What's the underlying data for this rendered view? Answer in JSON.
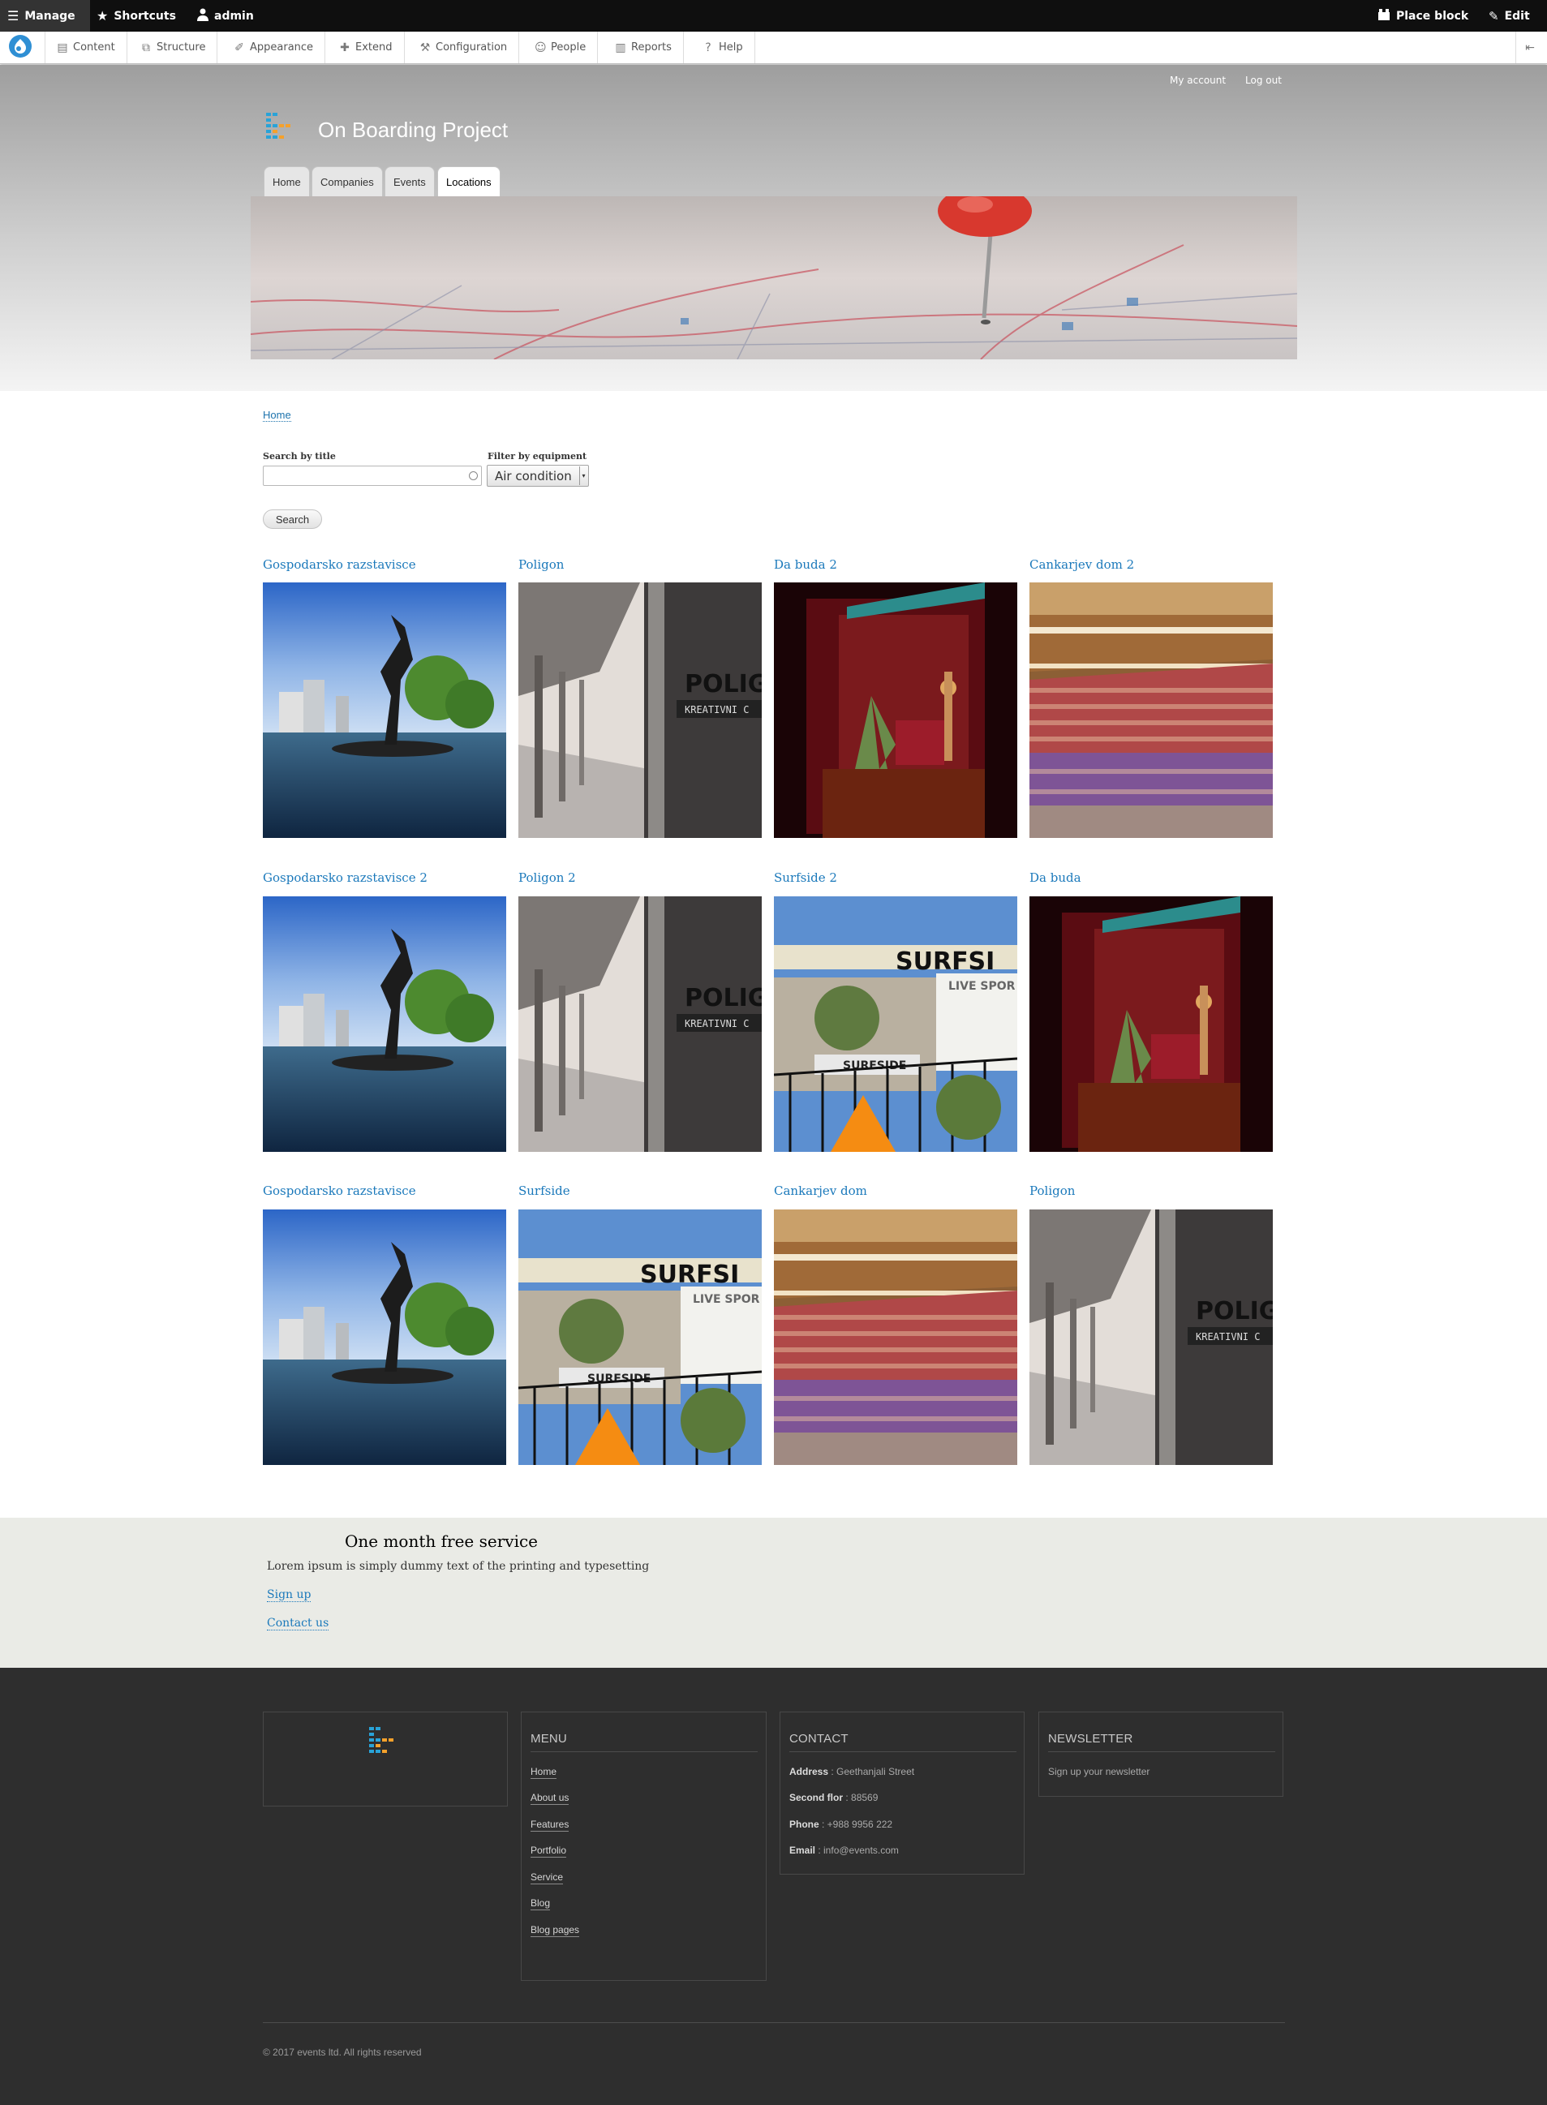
{
  "toolbar": {
    "manage": "Manage",
    "shortcuts": "Shortcuts",
    "user": "admin",
    "place_block": "Place block",
    "edit": "Edit"
  },
  "admin_tray": {
    "items": [
      "Content",
      "Structure",
      "Appearance",
      "Extend",
      "Configuration",
      "People",
      "Reports",
      "Help"
    ]
  },
  "header": {
    "my_account": "My account",
    "log_out": "Log out",
    "site_name": "On Boarding Project",
    "tabs": [
      "Home",
      "Companies",
      "Events",
      "Locations"
    ],
    "active_tab": "Locations"
  },
  "breadcrumb": {
    "home": "Home"
  },
  "filters": {
    "search_label": "Search by title",
    "search_value": "",
    "equipment_label": "Filter by equipment",
    "equipment_value": "Air condition",
    "search_button": "Search"
  },
  "locations": [
    {
      "title": "Gospodarsko razstavisce",
      "image": "fountain-statue"
    },
    {
      "title": "Poligon",
      "image": "poligon-corridor"
    },
    {
      "title": "Da buda 2",
      "image": "red-lounge"
    },
    {
      "title": "Cankarjev dom 2",
      "image": "concert-hall"
    },
    {
      "title": "Gospodarsko razstavisce 2",
      "image": "fountain-statue"
    },
    {
      "title": "Poligon 2",
      "image": "poligon-corridor"
    },
    {
      "title": "Surfside 2",
      "image": "surfside-terrace"
    },
    {
      "title": "Da buda",
      "image": "red-lounge"
    },
    {
      "title": "Gospodarsko razstavisce",
      "image": "fountain-statue"
    },
    {
      "title": "Surfside",
      "image": "surfside-terrace"
    },
    {
      "title": "Cankarjev dom",
      "image": "concert-hall"
    },
    {
      "title": "Poligon",
      "image": "poligon-corridor"
    }
  ],
  "promo": {
    "title": "One month free service",
    "text": "Lorem ipsum is simply dummy text of the printing and typesetting",
    "sign_up": "Sign up",
    "contact_us": "Contact us"
  },
  "footer": {
    "menu_title": "MENU",
    "menu_items": [
      "Home",
      "About us",
      "Features",
      "Portfolio",
      "Service",
      "Blog",
      "Blog pages"
    ],
    "contact_title": "CONTACT",
    "contact": [
      {
        "label": "Address",
        "value": " : Geethanjali Street"
      },
      {
        "label": "Second flor",
        "value": " : 88569"
      },
      {
        "label": "Phone",
        "value": " : +988 9956 222"
      },
      {
        "label": "Email",
        "value": " : info@events.com"
      }
    ],
    "newsletter_title": "NEWSLETTER",
    "newsletter_text": "Sign up your newsletter",
    "copyright": "© 2017 events ltd. All rights reserved"
  },
  "colors": {
    "link": "#1b79bb",
    "toolbar": "#0f0f0f",
    "footer": "#2e2e2e",
    "promo": "#eaebe6"
  }
}
